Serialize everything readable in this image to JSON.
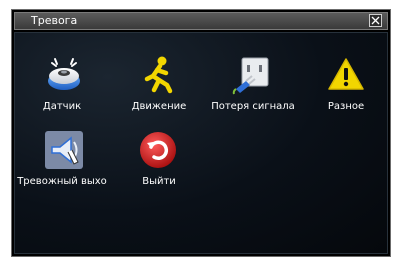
{
  "window": {
    "title": "Тревога"
  },
  "menu": {
    "items": [
      {
        "label": "Датчик",
        "icon": "sensor-icon"
      },
      {
        "label": "Движение",
        "icon": "motion-icon"
      },
      {
        "label": "Потеря сигнала",
        "icon": "signal-loss-icon"
      },
      {
        "label": "Разное",
        "icon": "warning-icon"
      },
      {
        "label": "Тревожный выхо",
        "icon": "alarm-output-icon"
      },
      {
        "label": "Выйти",
        "icon": "exit-icon"
      }
    ]
  },
  "colors": {
    "background": "#000000",
    "titlebar": "#4a4a4a",
    "text": "#ffffff",
    "warning": "#f2d600",
    "exit": "#c81e1e"
  }
}
